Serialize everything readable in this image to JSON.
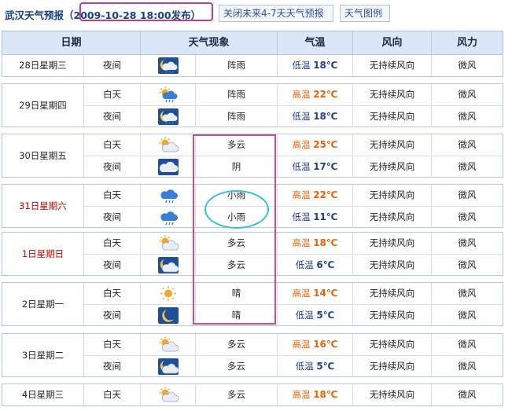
{
  "header": {
    "title": "武汉天气预报",
    "published": "（2009-10-28 18:00发布）",
    "btn_close": "关闭未来4-7天天气预报",
    "btn_legend": "天气图例"
  },
  "columns": [
    "日期",
    "天气现象",
    "气温",
    "风向",
    "风力"
  ],
  "colors": {
    "high_temp": "#e8630a",
    "low_temp": "#1f3f86",
    "holiday": "#cc0000",
    "highlight_rect": "#d04a8c",
    "highlight_ellipse": "#38c1d6"
  },
  "days": [
    {
      "date": "28日星期三",
      "rows": [
        {
          "period": "夜间",
          "icon": "night-shower-icon",
          "phen": "阵雨",
          "temp_label": "低温",
          "temp": "18℃",
          "dir": "无持续风向",
          "force": "微风"
        }
      ]
    },
    {
      "date": "29日星期四",
      "rows": [
        {
          "period": "白天",
          "icon": "day-shower-icon",
          "phen": "阵雨",
          "temp_label": "高温",
          "temp": "22℃",
          "dir": "无持续风向",
          "force": "微风"
        },
        {
          "period": "夜间",
          "icon": "night-shower-icon",
          "phen": "阵雨",
          "temp_label": "低温",
          "temp": "18℃",
          "dir": "无持续风向",
          "force": "微风"
        }
      ]
    },
    {
      "date": "30日星期五",
      "rows": [
        {
          "period": "白天",
          "icon": "partly-cloudy-day-icon",
          "phen": "多云",
          "temp_label": "高温",
          "temp": "25℃",
          "dir": "无持续风向",
          "force": "微风"
        },
        {
          "period": "夜间",
          "icon": "overcast-icon",
          "phen": "阴",
          "temp_label": "低温",
          "temp": "17℃",
          "dir": "无持续风向",
          "force": "微风"
        }
      ]
    },
    {
      "date": "31日星期六",
      "red": true,
      "rows": [
        {
          "period": "白天",
          "icon": "light-rain-icon",
          "phen": "小雨",
          "temp_label": "高温",
          "temp": "22℃",
          "dir": "无持续风向",
          "force": "微风"
        },
        {
          "period": "夜间",
          "icon": "light-rain-icon",
          "phen": "小雨",
          "temp_label": "低温",
          "temp": "11℃",
          "dir": "无持续风向",
          "force": "微风"
        }
      ]
    },
    {
      "date": "1日星期日",
      "red": true,
      "rows": [
        {
          "period": "白天",
          "icon": "partly-cloudy-day-icon",
          "phen": "多云",
          "temp_label": "高温",
          "temp": "18℃",
          "dir": "无持续风向",
          "force": "微风"
        },
        {
          "period": "夜间",
          "icon": "partly-cloudy-night-icon",
          "phen": "多云",
          "temp_label": "低温",
          "temp": "6℃",
          "dir": "无持续风向",
          "force": "微风"
        }
      ]
    },
    {
      "date": "2日星期一",
      "rows": [
        {
          "period": "白天",
          "icon": "sunny-icon",
          "phen": "晴",
          "temp_label": "高温",
          "temp": "14℃",
          "dir": "无持续风向",
          "force": "微风"
        },
        {
          "period": "夜间",
          "icon": "clear-night-icon",
          "phen": "晴",
          "temp_label": "低温",
          "temp": "5℃",
          "dir": "无持续风向",
          "force": "微风"
        }
      ]
    },
    {
      "date": "3日星期二",
      "rows": [
        {
          "period": "白天",
          "icon": "partly-cloudy-day-icon",
          "phen": "多云",
          "temp_label": "高温",
          "temp": "16℃",
          "dir": "无持续风向",
          "force": "微风"
        },
        {
          "period": "夜间",
          "icon": "partly-cloudy-night-icon",
          "phen": "多云",
          "temp_label": "低温",
          "temp": "5℃",
          "dir": "无持续风向",
          "force": "微风"
        }
      ]
    },
    {
      "date": "4日星期三",
      "rows": [
        {
          "period": "白天",
          "icon": "partly-cloudy-day-icon",
          "phen": "多云",
          "temp_label": "高温",
          "temp": "18℃",
          "dir": "无持续风向",
          "force": "微风"
        }
      ]
    }
  ]
}
